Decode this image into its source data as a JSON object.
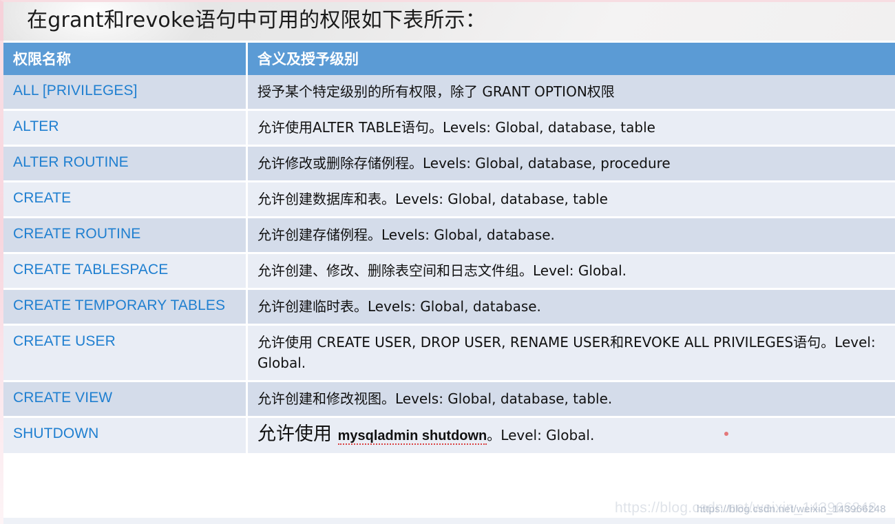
{
  "banner": {
    "title": "在grant和revoke语句中可用的权限如下表所示："
  },
  "table": {
    "headers": {
      "name": "权限名称",
      "description": "含义及授予级别"
    },
    "rows": [
      {
        "name": "ALL [PRIVILEGES]",
        "description": "授予某个特定级别的所有权限，除了 GRANT  OPTION权限"
      },
      {
        "name": "ALTER",
        "description": "允许使用ALTER  TABLE语句。Levels: Global, database, table"
      },
      {
        "name": "ALTER ROUTINE",
        "description": "允许修改或删除存储例程。Levels: Global, database, procedure"
      },
      {
        "name": "CREATE",
        "description": "允许创建数据库和表。Levels: Global, database, table"
      },
      {
        "name": "CREATE ROUTINE",
        "description": "允许创建存储例程。Levels: Global, database."
      },
      {
        "name": "CREATE TABLESPACE",
        "description": "允许创建、修改、删除表空间和日志文件组。Level: Global."
      },
      {
        "name": "CREATE TEMPORARY TABLES",
        "description": "允许创建临时表。Levels: Global, database."
      },
      {
        "name": "CREATE USER",
        "description": "允许使用 CREATE USER, DROP USER, RENAME USER和REVOKE ALL PRIVILEGES语句。Level: Global."
      },
      {
        "name": "CREATE VIEW",
        "description": "允许创建和修改视图。Levels: Global, database, table."
      },
      {
        "name": "SHUTDOWN",
        "description": "允许使用 mysqladmin shutdown。Level: Global.",
        "description_parts": {
          "lead": "允许使用 ",
          "command": "mysqladmin shutdown",
          "tail": "。Level: Global."
        }
      }
    ]
  },
  "watermark": {
    "text": "https://blog.csdn.net/weixin_143966248",
    "text_faint": "https://blog.csdn.net/weixin_143966248"
  },
  "colors": {
    "header_blue": "#5b9bd5",
    "name_text_blue": "#1f7fd0",
    "row_odd": "#d4dcea",
    "row_even": "#e9edf5",
    "banner_bg": "#efeeee",
    "edge_pink": "#f7d6de"
  }
}
